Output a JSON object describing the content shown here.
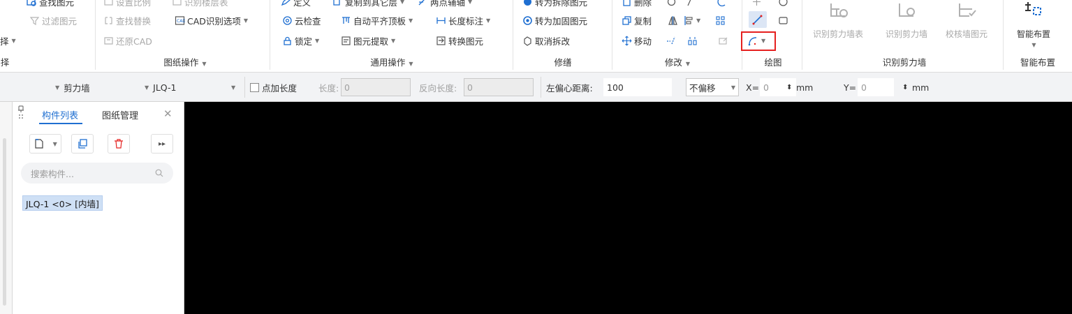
{
  "ribbon": {
    "col1": {
      "row1": "查找图元",
      "row2": "过滤图元",
      "partial_left": "择"
    },
    "col2": {
      "row1": "设置比例",
      "row1b": "识别楼层表",
      "row2a": "查找替换",
      "row2b": "CAD识别选项",
      "row3": "还原CAD"
    },
    "col3": {
      "row1a": "定义",
      "row1b": "复制到其它层",
      "row1c": "两点辅轴",
      "row2a": "云检查",
      "row2b": "自动平齐顶板",
      "row2c": "长度标注",
      "row3a": "锁定",
      "row3b": "图元提取",
      "row3c": "转换图元"
    },
    "col4": {
      "row1": "转为拆除图元",
      "row2": "转为加固图元",
      "row3": "取消拆改"
    },
    "col5": {
      "row1": "删除",
      "row2": "复制",
      "row3": "移动"
    },
    "big_buttons": {
      "recog_table": "识别剪力墙表",
      "recog_wall": "识别剪力墙",
      "check_wall": "校核墙图元",
      "smart_layout": "智能布置"
    },
    "groups": {
      "partial_left": "择",
      "drawing_ops": "图纸操作",
      "general_ops": "通用操作",
      "modify_shop": "修缮",
      "modify": "修改",
      "draw": "绘图",
      "recog_wall": "识别剪力墙",
      "smart_layout": "智能布置"
    },
    "accent": "#1f6fd1",
    "highlight": "#e5201f"
  },
  "propbar": {
    "type": "剪力墙",
    "name": "JLQ-1",
    "add_length_label": "点加长度",
    "length_label": "长度:",
    "length_value": "0",
    "reverse_length_label": "反向长度:",
    "reverse_length_value": "0",
    "offset_label": "左偏心距离:",
    "offset_value": "100",
    "offset_mode": "不偏移",
    "x_label": "X=",
    "x_value": "0",
    "unit1": "mm",
    "y_label": "Y=",
    "y_value": "0",
    "unit2": "mm"
  },
  "panel": {
    "tabs": [
      "构件列表",
      "图纸管理"
    ],
    "search_placeholder": "搜索构件...",
    "items": [
      "JLQ-1 <0> [内墙]"
    ]
  }
}
